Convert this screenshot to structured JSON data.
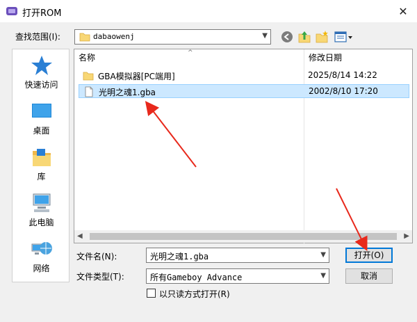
{
  "window": {
    "title": "打开ROM",
    "close_symbol": "✕"
  },
  "lookin": {
    "label": "查找范围(I):",
    "value": "dabaowenj"
  },
  "places": [
    {
      "label": "快速访问",
      "icon": "star-icon"
    },
    {
      "label": "桌面",
      "icon": "desktop-icon"
    },
    {
      "label": "库",
      "icon": "library-icon"
    },
    {
      "label": "此电脑",
      "icon": "computer-icon"
    },
    {
      "label": "网络",
      "icon": "network-icon"
    }
  ],
  "filelist": {
    "columns": {
      "name": "名称",
      "date": "修改日期"
    },
    "rows": [
      {
        "name": "GBA模拟器[PC端用]",
        "date": "2025/8/14 14:22",
        "type": "folder",
        "selected": false
      },
      {
        "name": "光明之魂1.gba",
        "date": "2002/8/10 17:20",
        "type": "file",
        "selected": true
      }
    ]
  },
  "form": {
    "filename_label": "文件名(N):",
    "filename_value": "光明之魂1.gba",
    "filetype_label": "文件类型(T):",
    "filetype_value": "所有Gameboy Advance",
    "readonly_label": "以只读方式打开(R)"
  },
  "buttons": {
    "open": "打开(O)",
    "cancel": "取消"
  },
  "colors": {
    "accent": "#0078d7",
    "selection": "#cce8ff",
    "annotation_arrow": "#e8291c",
    "folder": "#f8d775"
  }
}
